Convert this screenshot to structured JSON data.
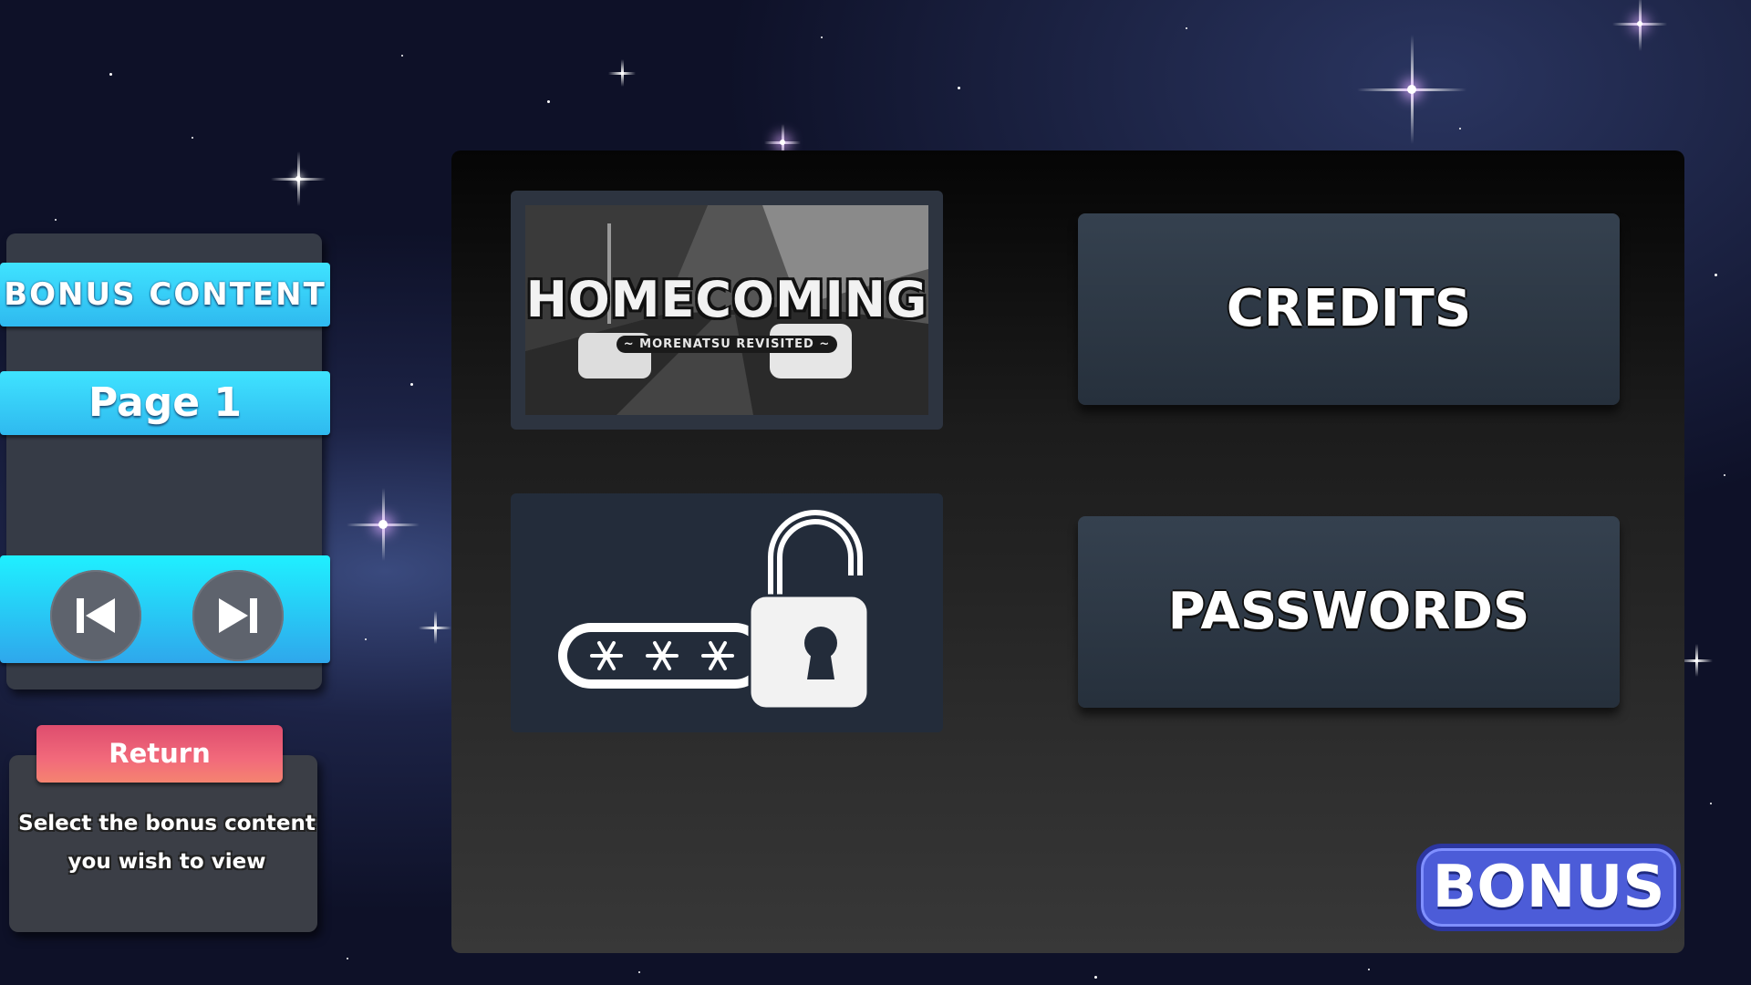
{
  "sidebar": {
    "title": "BONUS CONTENT",
    "page_label": "Page 1",
    "prev_icon": "skip-previous-icon",
    "next_icon": "skip-next-icon",
    "return_label": "Return",
    "hint_line1": "Select the bonus content",
    "hint_line2": "you wish to view"
  },
  "main": {
    "tiles": [
      {
        "title": "HOMECOMING",
        "subtitle": "~ MORENATSU REVISITED ~"
      },
      {
        "icon": "password-lock-icon"
      }
    ],
    "buttons": {
      "credits_label": "CREDITS",
      "passwords_label": "PASSWORDS"
    },
    "badge": "BONUS"
  },
  "colors": {
    "accent_cyan": "#3fe3ff",
    "return_red": "#de4d6e",
    "badge_blue": "#4c5cd8",
    "panel_dark": "#363b46"
  }
}
